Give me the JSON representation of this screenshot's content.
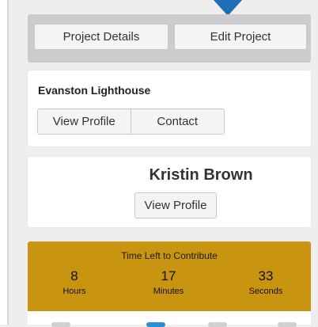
{
  "toolbar": {
    "project_details_label": "Project Details",
    "edit_project_label": "Edit Project"
  },
  "organization": {
    "name": "Evanston Lighthouse",
    "view_profile_label": "View Profile",
    "contact_label": "Contact"
  },
  "person": {
    "name": "Kristin Brown",
    "view_profile_label": "View Profile"
  },
  "countdown": {
    "title": "Time Left to Contribute",
    "hours": "8",
    "hours_label": "Hours",
    "minutes": "17",
    "minutes_label": "Minutes",
    "seconds": "33",
    "seconds_label": "Seconds"
  },
  "colors": {
    "accent": "#1e6fb3",
    "countdown_bg": "#c9940f"
  }
}
